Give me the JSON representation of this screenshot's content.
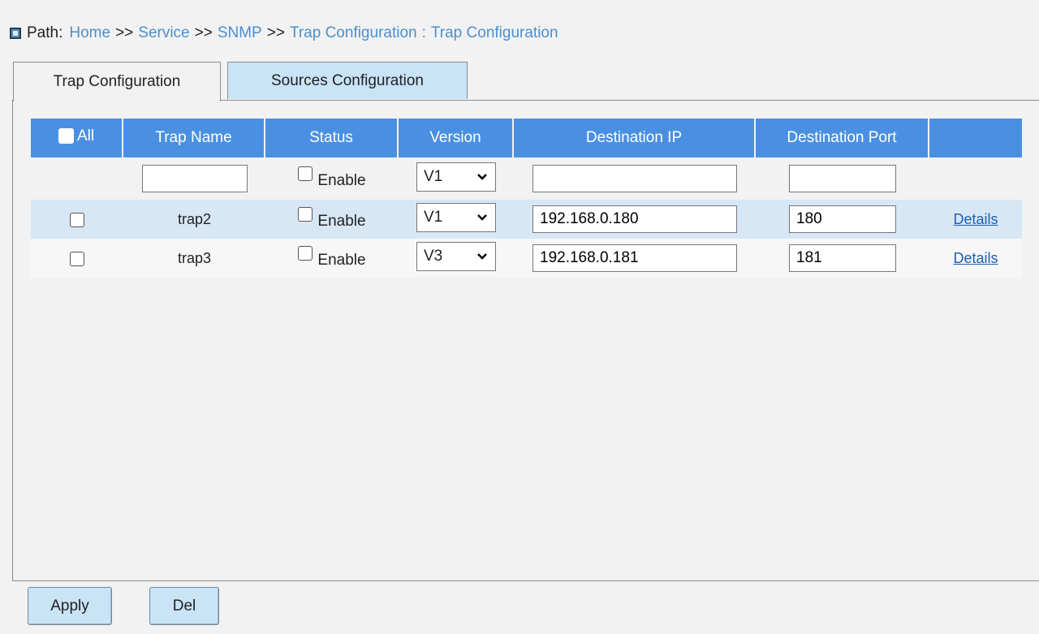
{
  "path": {
    "label": "Path:",
    "crumbs": [
      "Home",
      "Service",
      "SNMP",
      "Trap Configuration"
    ],
    "separator": ">>",
    "colon": ":",
    "current": "Trap Configuration"
  },
  "tabs": [
    {
      "label": "Trap Configuration",
      "active": true
    },
    {
      "label": "Sources Configuration",
      "active": false
    }
  ],
  "table": {
    "headers": {
      "all": "All",
      "trap_name": "Trap Name",
      "status": "Status",
      "version": "Version",
      "destination_ip": "Destination IP",
      "destination_port": "Destination Port"
    },
    "add_row": {
      "trap_name": "",
      "enable_label": "Enable",
      "version": "V1",
      "destination_ip": "",
      "destination_port": ""
    },
    "rows": [
      {
        "trap_name": "trap2",
        "enable_label": "Enable",
        "version": "V1",
        "destination_ip": "192.168.0.180",
        "destination_port": "180",
        "details": "Details"
      },
      {
        "trap_name": "trap3",
        "enable_label": "Enable",
        "version": "V3",
        "destination_ip": "192.168.0.181",
        "destination_port": "181",
        "details": "Details"
      }
    ]
  },
  "buttons": {
    "apply": "Apply",
    "del": "Del"
  },
  "colors": {
    "header_bg": "#4a90e2",
    "link": "#4a8fd0",
    "tab_inactive": "#c9e3f7",
    "row_alt": "#d8e7f6"
  }
}
